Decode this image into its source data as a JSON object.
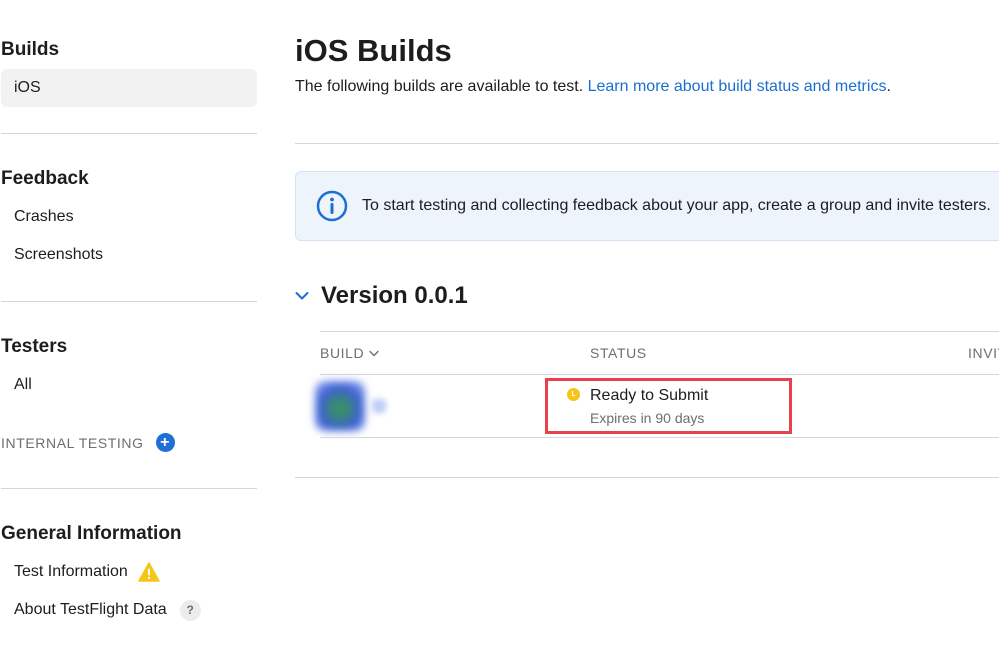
{
  "sidebar": {
    "builds": {
      "title": "Builds",
      "items": [
        {
          "label": "iOS"
        }
      ]
    },
    "feedback": {
      "title": "Feedback",
      "items": [
        {
          "label": "Crashes"
        },
        {
          "label": "Screenshots"
        }
      ]
    },
    "testers": {
      "title": "Testers",
      "items": [
        {
          "label": "All"
        }
      ],
      "internal_testing": "INTERNAL TESTING",
      "add_icon": "plus-circle-icon"
    },
    "general": {
      "title": "General Information",
      "items": [
        {
          "label": "Test Information",
          "icon": "warning-icon"
        },
        {
          "label": "About TestFlight Data",
          "icon": "help-icon",
          "icon_glyph": "?"
        }
      ]
    }
  },
  "main": {
    "title": "iOS Builds",
    "subtitle": "The following builds are available to test. ",
    "subtitle_link": "Learn more about build status and metrics",
    "subtitle_end": ".",
    "banner": {
      "icon": "info-circle-icon",
      "text": "To start testing and collecting feedback about your app, create a group and invite testers."
    },
    "version": {
      "title": "Version 0.0.1",
      "icon": "chevron-down-icon"
    },
    "table": {
      "columns": {
        "build": "BUILD",
        "status": "STATUS",
        "invites": "INVITES"
      },
      "rows": [
        {
          "status": "Ready to Submit",
          "status_sub": "Expires in 90 days",
          "status_color": "#f5c518"
        }
      ]
    }
  },
  "colors": {
    "accent": "#1f6fd6",
    "highlight": "#e8414b",
    "warning": "#f5c518"
  }
}
